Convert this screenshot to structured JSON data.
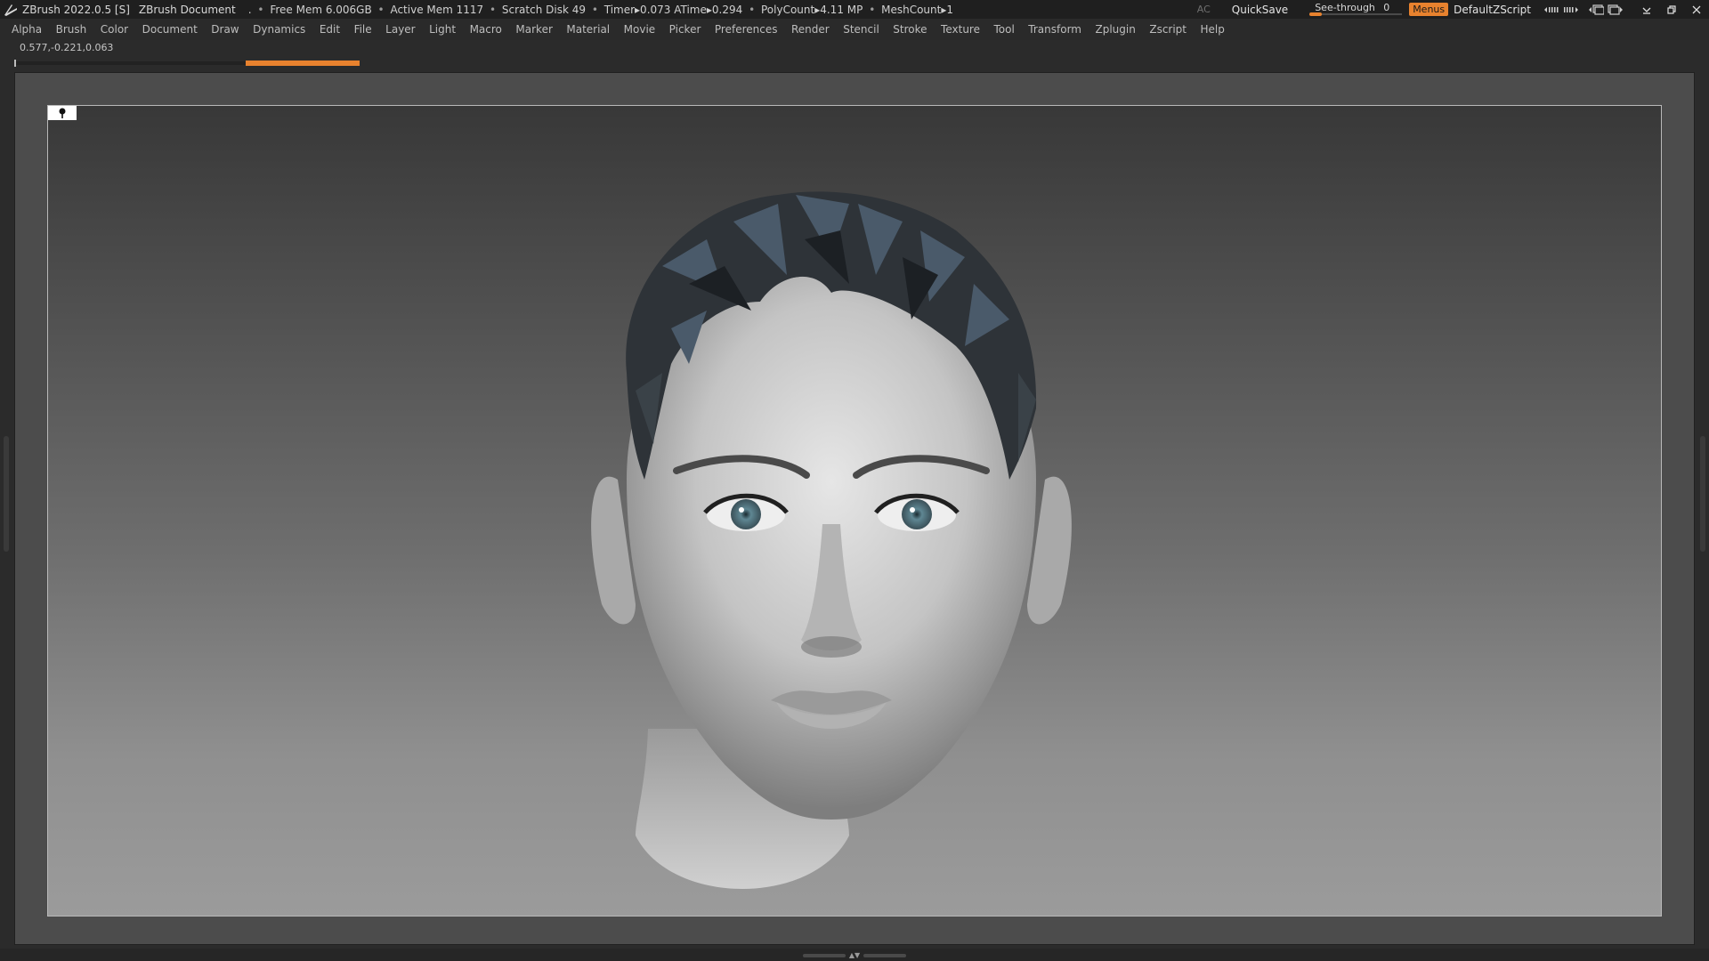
{
  "titlebar": {
    "app_title": "ZBrush 2022.0.5 [S]",
    "document": "ZBrush Document",
    "stats": [
      ".",
      "Free Mem 6.006GB",
      "Active Mem 1117",
      "Scratch Disk 49",
      "Timer▸0.073 ATime▸0.294",
      "PolyCount▸4.11 MP",
      "MeshCount▸1"
    ],
    "ac_label": "AC",
    "quicksave": "QuickSave",
    "seethrough_label": "See-through",
    "seethrough_value": "0",
    "menus_label": "Menus",
    "default_script": "DefaultZScript"
  },
  "menubar": {
    "items": [
      "Alpha",
      "Brush",
      "Color",
      "Document",
      "Draw",
      "Dynamics",
      "Edit",
      "File",
      "Layer",
      "Light",
      "Macro",
      "Marker",
      "Material",
      "Movie",
      "Picker",
      "Preferences",
      "Render",
      "Stencil",
      "Stroke",
      "Texture",
      "Tool",
      "Transform",
      "Zplugin",
      "Zscript",
      "Help"
    ]
  },
  "status": {
    "coordinates": "0.577,-0.221,0.063"
  },
  "colors": {
    "accent": "#e8822e",
    "titlebar_bg": "#1f1f1f",
    "menubar_bg": "#2a2a2a"
  },
  "icons": {
    "logo": "zbrush-logo-icon",
    "pin": "pin-icon"
  }
}
